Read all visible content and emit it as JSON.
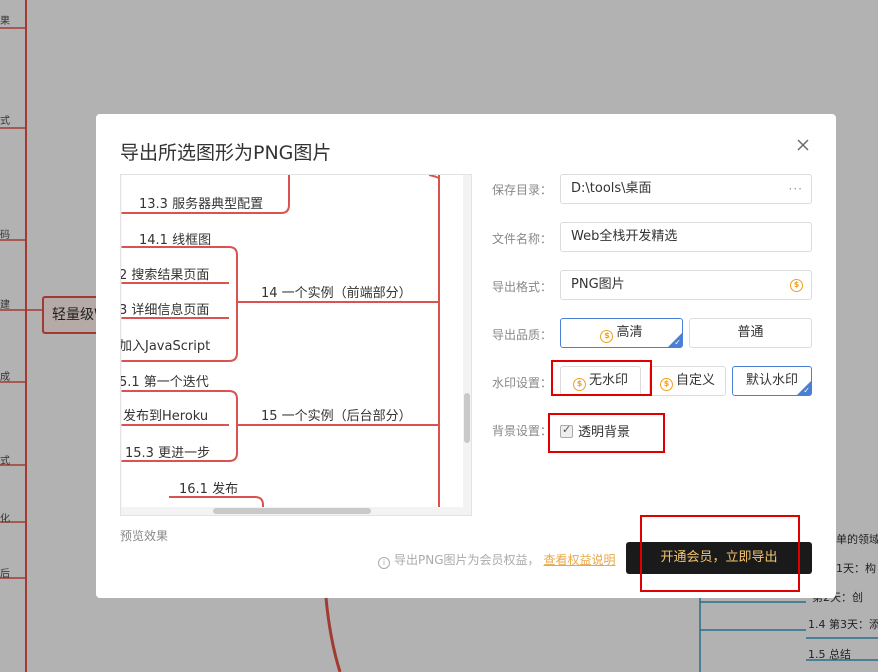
{
  "background": {
    "root_node": "轻量级W",
    "left_labels": [
      "果",
      "式",
      "码",
      "建",
      "成",
      "式",
      "化",
      "后"
    ],
    "right_nodes": [
      "单的领域",
      "1天：构",
      "第2天：创",
      "1.4 第3天：添",
      "1.5 总结"
    ]
  },
  "dialog": {
    "title": "导出所选图形为PNG图片",
    "preview": {
      "nodes": [
        "13.3 服务器典型配置",
        "14.1 线框图",
        "2 搜索结果页面",
        "3 详细信息页面",
        "加入JavaScript",
        "14 一个实例（前端部分）",
        "5.1 第一个迭代",
        "发布到Heroku",
        "15.3 更进一步",
        "15 一个实例（后台部分）",
        "16.1 发布"
      ],
      "caption": "预览效果"
    },
    "form": {
      "save_dir": {
        "label": "保存目录：",
        "value": "D:\\tools\\桌面",
        "more": "···"
      },
      "file_name": {
        "label": "文件名称：",
        "value": "Web全栈开发精选"
      },
      "format": {
        "label": "导出格式：",
        "value": "PNG图片"
      },
      "quality": {
        "label": "导出品质：",
        "options": [
          "高清",
          "普通"
        ],
        "selected": "高清"
      },
      "watermark": {
        "label": "水印设置：",
        "options": [
          "无水印",
          "自定义",
          "默认水印"
        ],
        "selected": "默认水印"
      },
      "background": {
        "label": "背景设置：",
        "checkbox_label": "透明背景",
        "checked": true
      }
    },
    "footer": {
      "info_text": "导出PNG图片为会员权益，",
      "info_link": "查看权益说明",
      "export_button": "开通会员，立即导出"
    }
  },
  "colors": {
    "accent": "#4a7fd6",
    "mindmap_line": "#d9534f",
    "annotation": "#e00000",
    "vip_gold": "#f0a020",
    "button_dark": "#1a1a1a",
    "overlay": "#b2b2b2"
  }
}
